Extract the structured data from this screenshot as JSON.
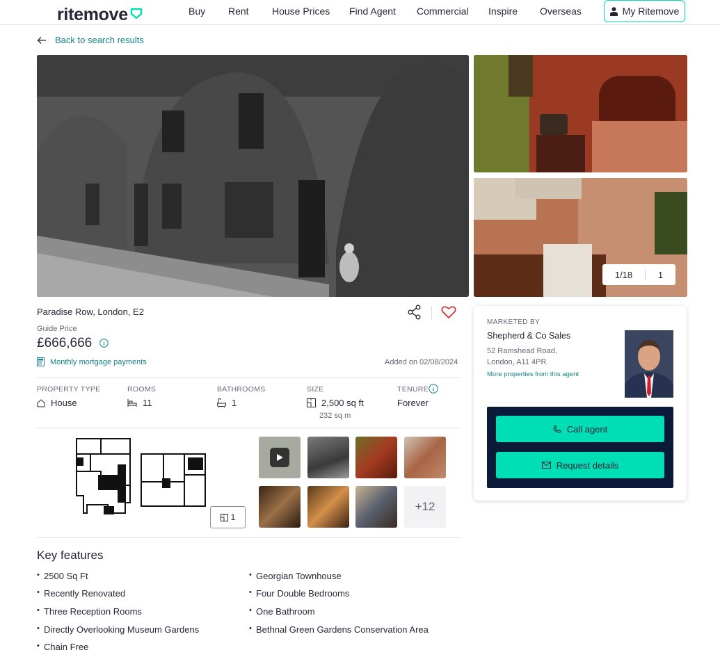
{
  "header": {
    "logo_text": "ritemove",
    "nav": [
      "Buy",
      "Rent",
      "House Prices",
      "Find Agent",
      "Commercial",
      "Inspire",
      "Overseas"
    ],
    "account_label": "My Ritemove",
    "accent": "#00deb6"
  },
  "back_link": "Back to search results",
  "gallery": {
    "counter": "1/18",
    "floorplan_count": "1"
  },
  "listing": {
    "address": "Paradise Row, London, E2",
    "price_label": "Guide Price",
    "price": "£666,666",
    "mortgage_link": "Monthly mortgage payments",
    "added": "Added on 02/08/2024"
  },
  "details": {
    "property_type": {
      "label": "PROPERTY TYPE",
      "value": "House"
    },
    "rooms": {
      "label": "ROOMS",
      "value": "11"
    },
    "bathrooms": {
      "label": "BATHROOMS",
      "value": "1"
    },
    "size": {
      "label": "SIZE",
      "value": "2,500 sq ft",
      "sub": "232 sq m"
    },
    "tenure": {
      "label": "TENURE",
      "value": "Forever"
    }
  },
  "media": {
    "floorplan_button": "1",
    "more_photos": "+12"
  },
  "key_features": {
    "title": "Key features",
    "items": [
      "2500 Sq Ft",
      "Georgian Townhouse",
      "Recently Renovated",
      "Four Double Bedrooms",
      "Three Reception Rooms",
      "One Bathroom",
      "Directly Overlooking Museum Gardens",
      "Bethnal Green Gardens Conservation Area",
      "Chain Free"
    ]
  },
  "agent": {
    "marketed_by_label": "MARKETED BY",
    "name": "Shepherd & Co Sales",
    "address_line1": "52 Ramshead Road,",
    "address_line2": "London, A11 4PR",
    "more_link": "More properties from this agent",
    "call_label": "Call agent",
    "request_label": "Request details"
  }
}
